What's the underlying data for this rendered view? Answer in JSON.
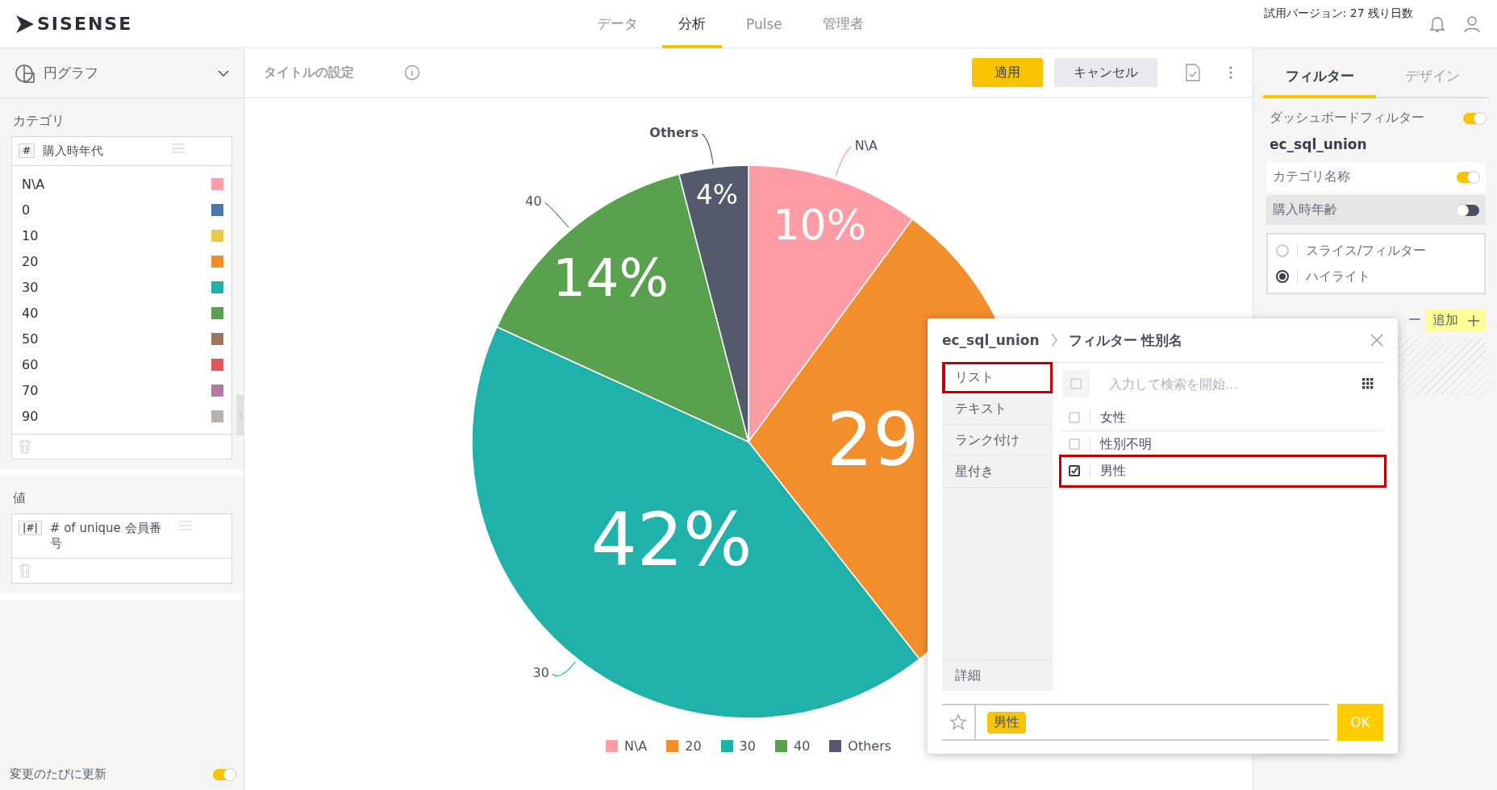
{
  "top_bar": {
    "logo": "SISENSE",
    "nav": [
      {
        "label": "データ",
        "selected": false
      },
      {
        "label": "分析",
        "selected": true
      },
      {
        "label": "Pulse",
        "selected": false
      },
      {
        "label": "管理者",
        "selected": false
      }
    ],
    "trial_text": "試用バージョン: 27 残り日数"
  },
  "left_panel": {
    "widget_type": "円グラフ",
    "category_section": {
      "title": "カテゴリ",
      "field": {
        "badge": "#",
        "name": "購入時年代"
      },
      "items": [
        {
          "label": "N\\A",
          "color": "#ff9ca6"
        },
        {
          "label": "0",
          "color": "#4a76a8"
        },
        {
          "label": "10",
          "color": "#edc948"
        },
        {
          "label": "20",
          "color": "#f28e2b"
        },
        {
          "label": "30",
          "color": "#20b2aa"
        },
        {
          "label": "40",
          "color": "#59a14f"
        },
        {
          "label": "50",
          "color": "#9c755f"
        },
        {
          "label": "60",
          "color": "#e15759"
        },
        {
          "label": "70",
          "color": "#b07aa1"
        },
        {
          "label": "90",
          "color": "#bab0ac"
        }
      ]
    },
    "value_section": {
      "title": "値",
      "field": {
        "badge": "|#|",
        "name": "# of unique 会員番号"
      }
    },
    "auto_update": {
      "label": "変更のたびに更新",
      "on": true
    }
  },
  "toolbar": {
    "title_placeholder": "タイトルの設定",
    "apply": "適用",
    "cancel": "キャンセル"
  },
  "chart": {
    "chart_data": {
      "type": "pie",
      "categories": [
        "N\\A",
        "20",
        "30",
        "40",
        "Others"
      ],
      "values": [
        10,
        29,
        42,
        14,
        4
      ],
      "colors": [
        "#ff9ca6",
        "#f28e2b",
        "#20b2aa",
        "#59a14f",
        "#525a6b"
      ],
      "value_labels": [
        "10%",
        "29",
        "42%",
        "14%",
        "4%"
      ]
    }
  },
  "right_panel": {
    "tabs": [
      {
        "label": "フィルター",
        "selected": true
      },
      {
        "label": "デザイン",
        "selected": false
      }
    ],
    "dashboard_filter": {
      "label": "ダッシュボードフィルター",
      "on": true
    },
    "source": "ec_sql_union",
    "filters": [
      {
        "label": "カテゴリ名称",
        "on": true,
        "selected": false
      },
      {
        "label": "購入時年齢",
        "on": false,
        "selected": true
      }
    ],
    "modes": [
      {
        "label": "スライス/フィルター",
        "selected": false
      },
      {
        "label": "ハイライト",
        "selected": true
      }
    ],
    "widget_filters": {
      "label": "ー",
      "add": "追加"
    }
  },
  "filter_dialog": {
    "source": "ec_sql_union",
    "title": "フィルター 性別名",
    "tabs": [
      {
        "label": "リスト",
        "selected": true,
        "annotated": true
      },
      {
        "label": "テキスト",
        "selected": false,
        "annotated": false
      },
      {
        "label": "ランク付け",
        "selected": false,
        "annotated": false
      },
      {
        "label": "星付き",
        "selected": false,
        "annotated": false
      }
    ],
    "advanced": "詳細",
    "search": {
      "placeholder": "入力して検索を開始...",
      "select_all_checked": false
    },
    "items": [
      {
        "label": "女性",
        "checked": false,
        "annotated": false
      },
      {
        "label": "性別不明",
        "checked": false,
        "annotated": false
      },
      {
        "label": "男性",
        "checked": true,
        "annotated": true
      }
    ],
    "chips": [
      "男性"
    ],
    "ok": "OK"
  }
}
